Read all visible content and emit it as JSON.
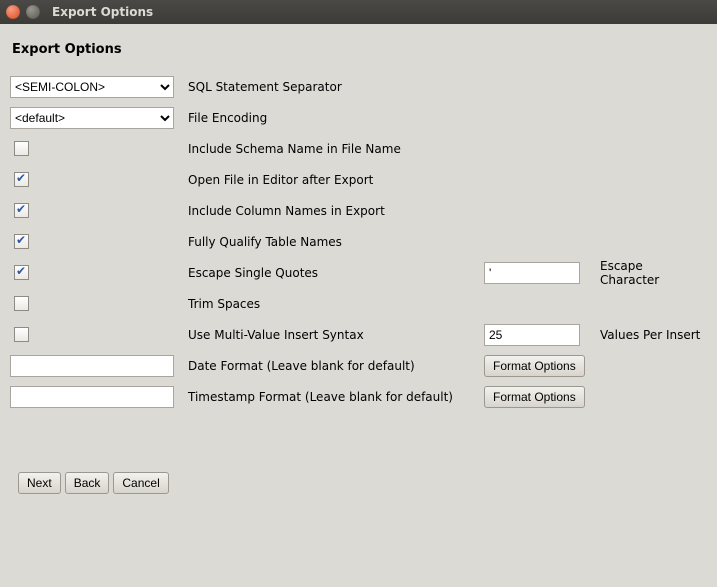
{
  "window": {
    "title": "Export Options"
  },
  "page_title": "Export Options",
  "separator": {
    "value": "<SEMI-COLON>",
    "label": "SQL Statement Separator"
  },
  "encoding": {
    "value": "<default>",
    "label": "File Encoding"
  },
  "include_schema": {
    "checked": false,
    "label": "Include Schema Name in File Name"
  },
  "open_after": {
    "checked": true,
    "label": "Open File in Editor after Export"
  },
  "include_cols": {
    "checked": true,
    "label": "Include Column Names in Export"
  },
  "qualify_tables": {
    "checked": true,
    "label": "Fully Qualify Table Names"
  },
  "escape_quotes": {
    "checked": true,
    "label": "Escape Single Quotes",
    "char_value": "'",
    "char_label": "Escape Character"
  },
  "trim_spaces": {
    "checked": false,
    "label": "Trim Spaces"
  },
  "multi_value": {
    "checked": false,
    "label": "Use Multi-Value Insert Syntax",
    "per_insert_value": "25",
    "per_insert_label": "Values Per Insert"
  },
  "date_format": {
    "value": "",
    "label": "Date Format (Leave blank for default)",
    "button": "Format Options"
  },
  "ts_format": {
    "value": "",
    "label": "Timestamp Format (Leave blank for default)",
    "button": "Format Options"
  },
  "footer": {
    "next": "Next",
    "back": "Back",
    "cancel": "Cancel"
  }
}
